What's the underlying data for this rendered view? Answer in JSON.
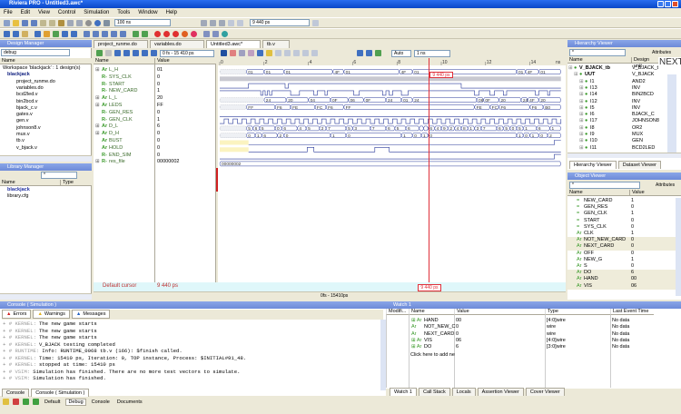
{
  "window": {
    "title": "Riviera PRO - Untitled3.awc*"
  },
  "menu": [
    "File",
    "Edit",
    "View",
    "Control",
    "Simulation",
    "Tools",
    "Window",
    "Help"
  ],
  "toolbar": {
    "time_step": "100 ns",
    "time_readout": "9 440 ps"
  },
  "doc_tabs": [
    "project_runme.do",
    "variables.do",
    "Untitled3.awc*",
    "tb.v"
  ],
  "design_manager": {
    "title": "Design Manager",
    "config": "debug",
    "col_name": "Name",
    "tree": [
      "Workspace 'blackjack' : 1 design(s)",
      "blackjack",
      "project_runme.do",
      "variables.do",
      "bcd2led.v",
      "bin2bcd.v",
      "bjack_c.v",
      "gates.v",
      "gen.v",
      "johnson8.v",
      "mux.v",
      "tb.v",
      "v_bjack.v"
    ]
  },
  "library_manager": {
    "title": "Library Manager",
    "filter": "*",
    "col_name": "Name",
    "col_type": "Type",
    "items": [
      "blackjack",
      "library.cfg"
    ]
  },
  "waveform": {
    "range": "0 fs - 15 410 ps",
    "zoom": "Auto",
    "step": "1 ns",
    "col_name": "Name",
    "col_value": "Value",
    "ruler": [
      "0",
      "2",
      "4",
      "6",
      "8",
      "10",
      "12",
      "14"
    ],
    "unit": "ns",
    "cursor": {
      "time_ns": 9.44,
      "label": "9 440 ps"
    },
    "default_cursor": "Default cursor",
    "default_cursor_value": "9 440 ps",
    "status": "0fs - 15410ps",
    "signals": [
      {
        "name": "L_H",
        "type": "Ar",
        "expand": true,
        "value": "01",
        "kind": "bus",
        "wave": [
          [
            0,
            "XX"
          ],
          [
            1.2,
            "01"
          ],
          [
            2.0,
            "01"
          ],
          [
            2.9,
            "01"
          ],
          [
            5.1,
            "4F"
          ],
          [
            5.6,
            "01"
          ],
          [
            8.1,
            "4F"
          ],
          [
            8.7,
            "01"
          ],
          [
            13.4,
            "01"
          ],
          [
            13.8,
            "4F"
          ],
          [
            14.4,
            "01"
          ]
        ]
      },
      {
        "name": "SYS_CLK",
        "type": "R-",
        "value": "0",
        "kind": "band",
        "wave": []
      },
      {
        "name": "START",
        "type": "R-",
        "value": "0",
        "kind": "bit",
        "wave": [
          [
            0,
            0
          ],
          [
            1.3,
            1
          ],
          [
            2.95,
            0
          ],
          [
            3.1,
            1
          ],
          [
            10.9,
            0
          ]
        ]
      },
      {
        "name": "NEW_CARD",
        "type": "R-",
        "value": "1",
        "kind": "bit",
        "wave": [
          [
            0,
            1
          ],
          [
            1.85,
            0
          ],
          [
            1.95,
            1
          ],
          [
            2.05,
            0
          ],
          [
            2.15,
            1
          ],
          [
            2.25,
            0
          ],
          [
            2.35,
            1
          ],
          [
            3.2,
            0
          ],
          [
            3.6,
            1
          ],
          [
            4.25,
            0
          ],
          [
            4.4,
            1
          ],
          [
            4.75,
            0
          ],
          [
            4.85,
            1
          ],
          [
            6.05,
            0
          ],
          [
            6.3,
            1
          ],
          [
            7.35,
            0
          ],
          [
            7.5,
            1
          ],
          [
            7.65,
            0
          ],
          [
            7.8,
            1
          ],
          [
            8.2,
            0
          ],
          [
            8.5,
            1
          ],
          [
            11.5,
            0
          ],
          [
            11.7,
            1
          ],
          [
            12.2,
            0
          ],
          [
            12.4,
            1
          ],
          [
            12.8,
            0
          ],
          [
            12.95,
            1
          ],
          [
            14.25,
            0
          ],
          [
            14.4,
            1
          ],
          [
            14.8,
            0
          ],
          [
            14.9,
            1
          ]
        ]
      },
      {
        "name": "L_L",
        "type": "Ar",
        "expand": true,
        "value": "20",
        "kind": "bus",
        "wave": [
          [
            0,
            "XX"
          ],
          [
            2.0,
            "24"
          ],
          [
            3.0,
            "20"
          ],
          [
            4.0,
            "04"
          ],
          [
            5.0,
            "0F"
          ],
          [
            5.8,
            "06"
          ],
          [
            6.5,
            "0F"
          ],
          [
            7.5,
            "24"
          ],
          [
            8.2,
            "01"
          ],
          [
            8.7,
            "24"
          ],
          [
            11.6,
            "06"
          ],
          [
            11.9,
            "0F"
          ],
          [
            12.6,
            "20"
          ],
          [
            13.6,
            "24"
          ],
          [
            13.9,
            "4F"
          ],
          [
            14.4,
            "20"
          ]
        ]
      },
      {
        "name": "LEDS",
        "type": "Ar",
        "expand": true,
        "value": "FF",
        "kind": "bus",
        "wave": [
          [
            0,
            "XX"
          ],
          [
            1.2,
            "FF"
          ],
          [
            2.5,
            "F6"
          ],
          [
            3.2,
            "FE"
          ],
          [
            4.3,
            "FC"
          ],
          [
            4.8,
            "F6"
          ],
          [
            5.6,
            "FF"
          ],
          [
            11.5,
            "FE"
          ],
          [
            12.2,
            "FC"
          ],
          [
            12.6,
            "F6"
          ],
          [
            14.0,
            "F6"
          ],
          [
            14.6,
            "B0"
          ]
        ]
      },
      {
        "name": "GEN_RES",
        "type": "R-",
        "value": "0",
        "kind": "bit",
        "wave": [
          [
            0,
            0
          ]
        ]
      },
      {
        "name": "GEN_CLK",
        "type": "R-",
        "value": "1",
        "kind": "clock",
        "period_ns": 0.4
      },
      {
        "name": "D_L",
        "type": "Ar",
        "expand": true,
        "value": "6",
        "kind": "bus",
        "wave": [
          [
            0,
            "X"
          ],
          [
            1.2,
            "5"
          ],
          [
            1.5,
            "6"
          ],
          [
            1.8,
            "5"
          ],
          [
            2.5,
            "0"
          ],
          [
            2.8,
            "6"
          ],
          [
            3.5,
            "4"
          ],
          [
            3.9,
            "5"
          ],
          [
            4.5,
            "2"
          ],
          [
            4.8,
            "7"
          ],
          [
            5.7,
            "5"
          ],
          [
            6.0,
            "3"
          ],
          [
            6.8,
            "7"
          ],
          [
            7.5,
            "6"
          ],
          [
            7.9,
            "5"
          ],
          [
            8.4,
            "6"
          ],
          [
            9.0,
            "5"
          ],
          [
            9.2,
            "1"
          ],
          [
            9.4,
            "6"
          ],
          [
            9.7,
            "4"
          ],
          [
            10.0,
            "9"
          ],
          [
            10.3,
            "2"
          ],
          [
            10.6,
            "4"
          ],
          [
            10.9,
            "8"
          ],
          [
            11.2,
            "1"
          ],
          [
            11.5,
            "3"
          ],
          [
            11.8,
            "7"
          ],
          [
            12.5,
            "6"
          ],
          [
            12.8,
            "5"
          ],
          [
            13.1,
            "0"
          ],
          [
            13.4,
            "5"
          ],
          [
            13.7,
            "1"
          ],
          [
            14.3,
            "6"
          ],
          [
            14.9,
            "1"
          ]
        ]
      },
      {
        "name": "D_H",
        "type": "Ar",
        "expand": true,
        "value": "0",
        "kind": "bus",
        "wave": [
          [
            0,
            "X"
          ],
          [
            1.2,
            "0"
          ],
          [
            1.6,
            "1"
          ],
          [
            1.9,
            "6"
          ],
          [
            2.6,
            "2"
          ],
          [
            2.9,
            "0"
          ],
          [
            5.0,
            "1"
          ],
          [
            5.7,
            "0"
          ],
          [
            8.2,
            "1"
          ],
          [
            8.7,
            "0"
          ],
          [
            9.1,
            "1"
          ],
          [
            9.4,
            "0"
          ],
          [
            13.4,
            "1"
          ],
          [
            13.7,
            "0"
          ],
          [
            14.0,
            "1"
          ],
          [
            14.4,
            "0"
          ],
          [
            14.8,
            "2"
          ]
        ]
      },
      {
        "name": "BUST",
        "type": "Ar",
        "value": "0",
        "kind": "bit",
        "wave": [
          [
            0,
            null
          ],
          [
            1.3,
            0
          ],
          [
            15.1,
            1
          ]
        ]
      },
      {
        "name": "HOLD",
        "type": "Ar",
        "value": "0",
        "kind": "bit",
        "wave": [
          [
            0,
            null
          ],
          [
            1.3,
            0
          ],
          [
            3.95,
            1
          ],
          [
            4.25,
            0
          ],
          [
            7.0,
            1
          ],
          [
            7.65,
            0
          ]
        ]
      },
      {
        "name": "END_SIM",
        "type": "R-",
        "value": "0",
        "kind": "bit",
        "wave": [
          [
            0,
            0
          ],
          [
            15.1,
            1
          ]
        ]
      },
      {
        "name": "res_file",
        "type": "R-",
        "expand": true,
        "value": "00000002",
        "kind": "bus",
        "wave": [
          [
            0,
            "00000002"
          ]
        ]
      }
    ]
  },
  "hierarchy": {
    "title": "Hierarchy Viewer",
    "filter": "*",
    "attributes": "Attributes",
    "col_name": "Name",
    "col_unit": "Design unit",
    "next_label": "NEXT",
    "rows": [
      {
        "name": "V_BJACK_tb",
        "unit": "V_BJACK_t"
      },
      {
        "name": "UUT",
        "unit": "V_BJACK"
      },
      {
        "name": "I1",
        "unit": "AND2"
      },
      {
        "name": "I13",
        "unit": "INV"
      },
      {
        "name": "I14",
        "unit": "BIN2BCD"
      },
      {
        "name": "I12",
        "unit": "INV"
      },
      {
        "name": "I5",
        "unit": "INV"
      },
      {
        "name": "I6",
        "unit": "BJACK_C"
      },
      {
        "name": "I17",
        "unit": "JOHNSON8"
      },
      {
        "name": "I8",
        "unit": "OR2"
      },
      {
        "name": "I9",
        "unit": "MUX"
      },
      {
        "name": "I10",
        "unit": "GEN"
      },
      {
        "name": "I11",
        "unit": "BCD2LED"
      }
    ],
    "tabs": [
      "Hierarchy Viewer",
      "Dataset Viewer"
    ]
  },
  "stack_viewer": {
    "title": "Object Viewer",
    "filter": "*",
    "attributes": "Attributes",
    "col_name": "Name",
    "col_value": "Value",
    "rows": [
      {
        "name": "NEW_CARD",
        "value": "1"
      },
      {
        "name": "GEN_RES",
        "value": "0"
      },
      {
        "name": "GEN_CLK",
        "value": "1"
      },
      {
        "name": "START",
        "value": "0"
      },
      {
        "name": "SYS_CLK",
        "value": "0"
      },
      {
        "name": "CLK",
        "value": "1"
      },
      {
        "name": "NOT_NEW_CARD",
        "value": "0"
      },
      {
        "name": "NEXT_CARD",
        "value": "0"
      },
      {
        "name": "OFF",
        "value": "0"
      },
      {
        "name": "NEW_G",
        "value": "1"
      },
      {
        "name": "S",
        "value": "0"
      },
      {
        "name": "DO",
        "value": "6"
      },
      {
        "name": "HAND",
        "value": "00"
      },
      {
        "name": "VIS",
        "value": "06"
      }
    ]
  },
  "console": {
    "title": "Console ( Simulation )",
    "filters": [
      "Errors",
      "Warnings",
      "Messages"
    ],
    "lines": [
      {
        "src": "KERNEL:",
        "text": "The new game starts"
      },
      {
        "src": "KERNEL:",
        "text": "The new game starts"
      },
      {
        "src": "KERNEL:",
        "text": "The new game starts"
      },
      {
        "src": "KERNEL:",
        "text": "V_BJACK testing completed"
      },
      {
        "src": "RUNTIME:",
        "text": "Info: RUNTIME_0068 tb.v (166): $finish called."
      },
      {
        "src": "KERNEL:",
        "text": "Time: 15410 ps,  Iteration: 0,  TOP instance,  Process: $INITIAL#91_48."
      },
      {
        "src": "KERNEL:",
        "text": "stopped at time: 15410 ps"
      },
      {
        "src": "VSIM:",
        "text": "Simulation has finished. There are no more test vectors to simulate."
      },
      {
        "src": "VSIM:",
        "text": "Simulation has finished."
      }
    ],
    "tabs": [
      "Console",
      "Console ( Simulation )"
    ]
  },
  "footer_tabs": [
    "Default",
    "Debug",
    "Console",
    "Documents"
  ],
  "watch": {
    "title": "Watch 1",
    "cols": [
      "Modifi...",
      "Name",
      "Value",
      "Type",
      "Last Event Time"
    ],
    "rows": [
      {
        "name": "HAND",
        "value": "00",
        "type": "[4:0]wire",
        "time": "No data"
      },
      {
        "name": "NOT_NEW_C",
        "value": "0",
        "type": "wire",
        "time": "No data"
      },
      {
        "name": "NEXT_CARD",
        "value": "0",
        "type": "wire",
        "time": "No data"
      },
      {
        "name": "VIS",
        "value": "06",
        "type": "[4:0]wire",
        "time": "No data"
      },
      {
        "name": "DO",
        "value": "6",
        "type": "[3:0]wire",
        "time": "No data"
      }
    ],
    "add_hint": "Click here to add ne",
    "tabs": [
      "Watch 1",
      "Call Stack",
      "Locals",
      "Assertion Viewer",
      "Cover Viewer"
    ]
  },
  "colors": {
    "titlebar": "#0a48c8",
    "panel_header": "#7a96df",
    "cursor": "#e0303a",
    "signal_green": "#3a9a2a",
    "wave": "#2a3a9a"
  }
}
